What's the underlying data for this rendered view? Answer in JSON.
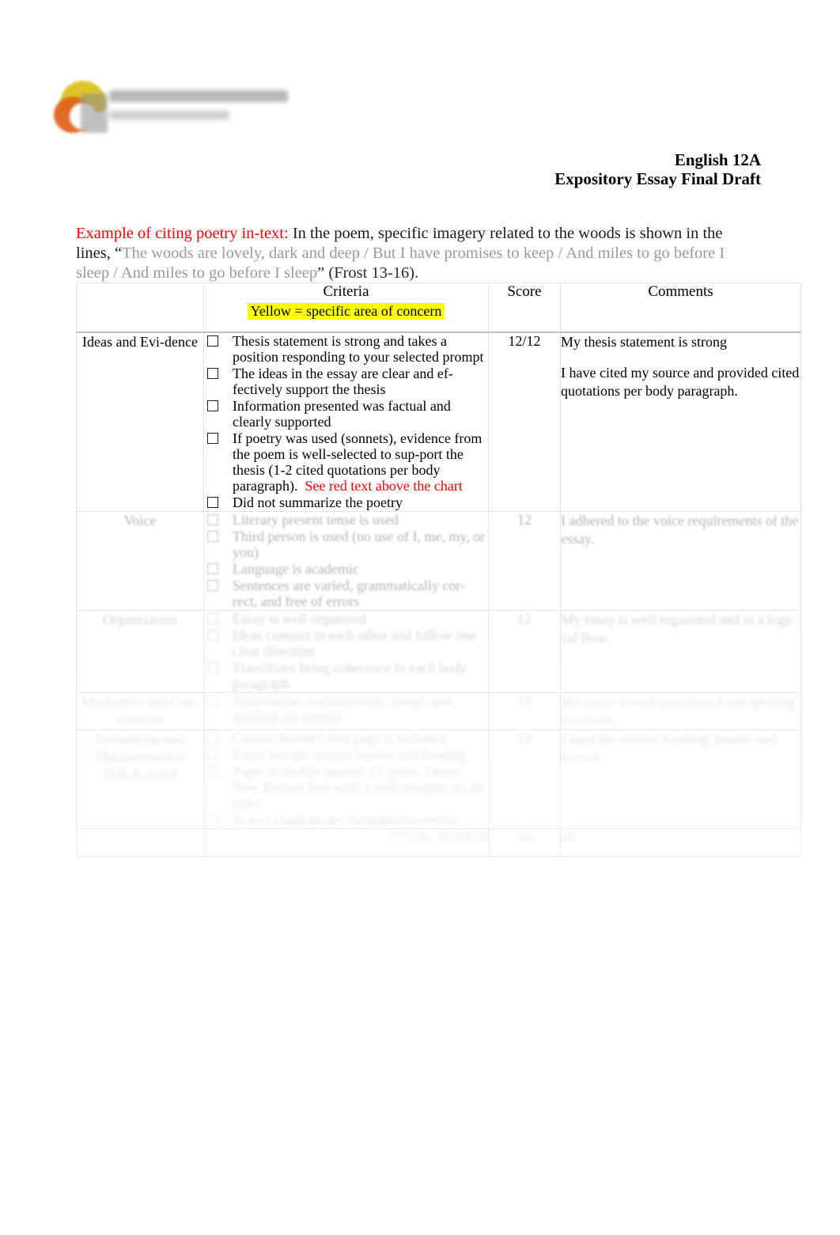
{
  "document": {
    "course": "English 12A",
    "assignment": "Expository Essay Final Draft"
  },
  "logo": {
    "alt": "college-logo"
  },
  "intro": {
    "label": "Example of citing poetry in-text:",
    "lead": " In the poem, specific imagery related to the woods is shown in the lines, “",
    "quote": "The woods are lovely, dark and deep / But I have promises to keep / And miles to go before I sleep / And miles to go before I sleep",
    "citation": "” (Frost 13-16)."
  },
  "table": {
    "headers": {
      "category": "",
      "criteria_title": "Criteria",
      "criteria_sub": "Yellow  = specific area of concern",
      "score": "Score",
      "comments": "Comments"
    },
    "rows": [
      {
        "category": "Ideas and Evi-dence",
        "items": [
          "Thesis statement is strong and takes a position responding to your selected prompt",
          "The ideas in the essay are clear and ef-fectively support the thesis",
          "Information presented was factual and clearly supported",
          "If poetry was used (sonnets), evidence from the poem is well-selected to sup-port the thesis (1-2 cited quotations per body paragraph).",
          "Did not summarize the poetry"
        ],
        "red_note": "See red text above the chart",
        "red_note_item_index": 3,
        "score": "12/12",
        "comments": [
          "My thesis statement is strong",
          "I have cited my source and provided cited quotations per body paragraph."
        ]
      },
      {
        "category": "Voice",
        "items": [
          "Literary present tense is used",
          "Third person is used (no use of I, me, my, or you)",
          "Language is academic",
          "Sentences are varied, grammatically cor-rect, and free of errors"
        ],
        "score": "12",
        "comments": [
          "I adhered to the voice requirements of the essay."
        ]
      },
      {
        "category": "Organization",
        "items": [
          "Essay is well organized",
          "Ideas connect to each other and follow one clear direction",
          "Transitions bring coherence to each body paragraph"
        ],
        "score": "12",
        "comments": [
          "My essay is well organized and in a logi-cal flow."
        ]
      },
      {
        "category": "Mechanics and Con-ventions",
        "items": [
          "Punctuation, capitalization, usage, and spelling are correct"
        ],
        "score": "12",
        "comments": [
          "My essay is well punctuated and spelling is correct."
        ]
      },
      {
        "category": "Formatting and Documentation (MLA style)",
        "items": [
          "Correct Works Cited page is included",
          "Essay has the correct header and heading",
          "Paper is double spaced, 12 point, Times New Roman font with 1 inch margins on all sides",
          "In-text citations are formatted correctly"
        ],
        "score": "12",
        "comments": [
          "I used the correct heading, header and format."
        ]
      }
    ],
    "total": {
      "label": "TOTAL POINTS",
      "score": "60",
      "out_of": "60"
    }
  },
  "colors": {
    "accent_red": "#ff0000",
    "highlight_yellow": "#ffff00",
    "quote_gray": "#9a9a9a",
    "border_gray": "#e2e2e2"
  }
}
